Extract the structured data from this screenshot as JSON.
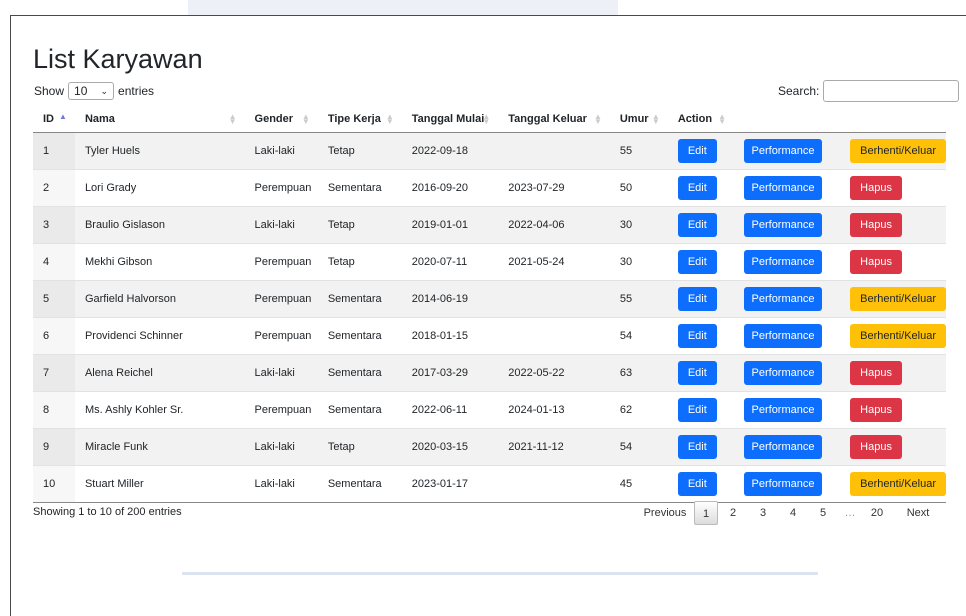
{
  "page": {
    "title": "List Karyawan"
  },
  "length_menu": {
    "show_label": "Show",
    "value": "10",
    "entries_label": "entries"
  },
  "search": {
    "label": "Search:",
    "value": "",
    "placeholder": ""
  },
  "table": {
    "columns": [
      "ID",
      "Nama",
      "Gender",
      "Tipe Kerja",
      "Tanggal Mulai",
      "Tanggal Keluar",
      "Umur",
      "Action"
    ],
    "rows": [
      {
        "id": "1",
        "nama": "Tyler Huels",
        "gender": "Laki-laki",
        "tipe": "Tetap",
        "mulai": "2022-09-18",
        "keluar": "",
        "umur": "55",
        "edit": "Edit",
        "performance": "Performance",
        "action": "Berhenti/Keluar"
      },
      {
        "id": "2",
        "nama": "Lori Grady",
        "gender": "Perempuan",
        "tipe": "Sementara",
        "mulai": "2016-09-20",
        "keluar": "2023-07-29",
        "umur": "50",
        "edit": "Edit",
        "performance": "Performance",
        "action": "Hapus"
      },
      {
        "id": "3",
        "nama": "Braulio Gislason",
        "gender": "Laki-laki",
        "tipe": "Tetap",
        "mulai": "2019-01-01",
        "keluar": "2022-04-06",
        "umur": "30",
        "edit": "Edit",
        "performance": "Performance",
        "action": "Hapus"
      },
      {
        "id": "4",
        "nama": "Mekhi Gibson",
        "gender": "Perempuan",
        "tipe": "Tetap",
        "mulai": "2020-07-11",
        "keluar": "2021-05-24",
        "umur": "30",
        "edit": "Edit",
        "performance": "Performance",
        "action": "Hapus"
      },
      {
        "id": "5",
        "nama": "Garfield Halvorson",
        "gender": "Perempuan",
        "tipe": "Sementara",
        "mulai": "2014-06-19",
        "keluar": "",
        "umur": "55",
        "edit": "Edit",
        "performance": "Performance",
        "action": "Berhenti/Keluar"
      },
      {
        "id": "6",
        "nama": "Providenci Schinner",
        "gender": "Perempuan",
        "tipe": "Sementara",
        "mulai": "2018-01-15",
        "keluar": "",
        "umur": "54",
        "edit": "Edit",
        "performance": "Performance",
        "action": "Berhenti/Keluar"
      },
      {
        "id": "7",
        "nama": "Alena Reichel",
        "gender": "Laki-laki",
        "tipe": "Sementara",
        "mulai": "2017-03-29",
        "keluar": "2022-05-22",
        "umur": "63",
        "edit": "Edit",
        "performance": "Performance",
        "action": "Hapus"
      },
      {
        "id": "8",
        "nama": "Ms. Ashly Kohler Sr.",
        "gender": "Perempuan",
        "tipe": "Sementara",
        "mulai": "2022-06-11",
        "keluar": "2024-01-13",
        "umur": "62",
        "edit": "Edit",
        "performance": "Performance",
        "action": "Hapus"
      },
      {
        "id": "9",
        "nama": "Miracle Funk",
        "gender": "Laki-laki",
        "tipe": "Tetap",
        "mulai": "2020-03-15",
        "keluar": "2021-11-12",
        "umur": "54",
        "edit": "Edit",
        "performance": "Performance",
        "action": "Hapus"
      },
      {
        "id": "10",
        "nama": "Stuart Miller",
        "gender": "Laki-laki",
        "tipe": "Sementara",
        "mulai": "2023-01-17",
        "keluar": "",
        "umur": "45",
        "edit": "Edit",
        "performance": "Performance",
        "action": "Berhenti/Keluar"
      }
    ]
  },
  "footer": {
    "info": "Showing 1 to 10 of 200 entries",
    "pagination": {
      "previous": "Previous",
      "current": "1",
      "pages": [
        "2",
        "3",
        "4",
        "5"
      ],
      "ellipsis": "…",
      "last": "20",
      "next": "Next"
    }
  },
  "colors": {
    "primary": "#0d6efd",
    "danger": "#dc3545",
    "warning": "#ffc107"
  },
  "icons": {
    "sort": "sort-arrows-icon",
    "sort_asc": "sort-asc-icon",
    "dropdown": "chevron-down-icon"
  }
}
